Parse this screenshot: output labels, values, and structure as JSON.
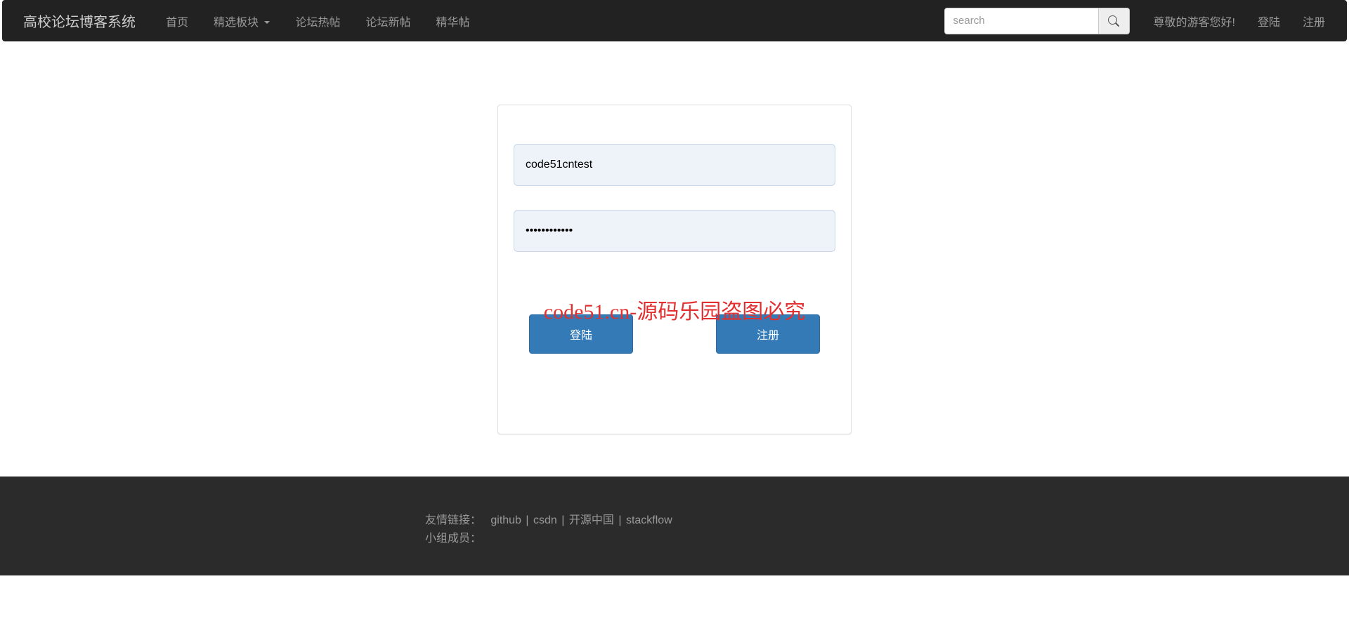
{
  "navbar": {
    "brand": "高校论坛博客系统",
    "items": [
      {
        "label": "首页"
      },
      {
        "label": "精选板块"
      },
      {
        "label": "论坛热帖"
      },
      {
        "label": "论坛新帖"
      },
      {
        "label": "精华帖"
      }
    ],
    "search_placeholder": "search",
    "guest_greeting": "尊敬的游客您好!",
    "login_label": "登陆",
    "register_label": "注册"
  },
  "login_form": {
    "username_value": "code51cntest",
    "password_value": "••••••••••••",
    "login_button": "登陆",
    "register_button": "注册"
  },
  "watermark": "code51.cn-源码乐园盗图必究",
  "footer": {
    "links_label": "友情链接：",
    "links": [
      {
        "label": "github"
      },
      {
        "label": "csdn"
      },
      {
        "label": "开源中国"
      },
      {
        "label": "stackflow"
      }
    ],
    "team_label": "小组成员："
  }
}
